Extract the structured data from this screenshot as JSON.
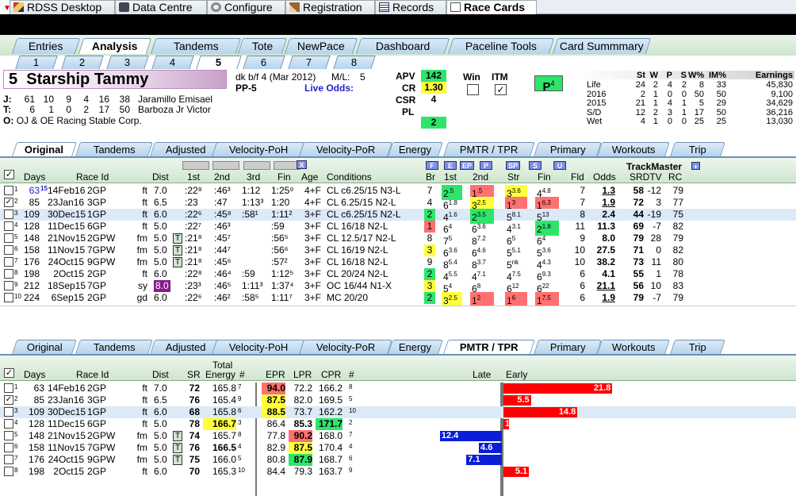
{
  "top_tabs": [
    {
      "label": "RDSS Desktop",
      "icon": "pencil-icon"
    },
    {
      "label": "Data Centre",
      "icon": "camera-icon"
    },
    {
      "label": "Configure",
      "icon": "gear-icon"
    },
    {
      "label": "Registration",
      "icon": "edit-icon"
    },
    {
      "label": "Records",
      "icon": "grid-icon"
    },
    {
      "label": "Race Cards",
      "icon": "document-icon"
    }
  ],
  "main_tabs": [
    "Entries",
    "Analysis",
    "Tandems",
    "Tote",
    "NewPace",
    "Dashboard",
    "Paceline Tools",
    "Card Summmary"
  ],
  "num_tabs": [
    "1",
    "2",
    "3",
    "4",
    "5",
    "6",
    "7",
    "8"
  ],
  "horse": {
    "number": "5",
    "name": "Starship Tammy",
    "breeding": "dk b/f 4  (Mar 2012)",
    "ml_label": "M/L:",
    "ml_value": "5",
    "pp": "PP-5",
    "live_odds": "Live Odds:",
    "jockey_label": "J:",
    "jockey_stats": [
      "61",
      "10",
      "9",
      "4",
      "16",
      "38"
    ],
    "jockey_name": "Jaramillo Emisael",
    "trainer_label": "T:",
    "trainer_stats": [
      "6",
      "1",
      "0",
      "2",
      "17",
      "50"
    ],
    "trainer_name": "Barboza Jr Victor",
    "owner_label": "O:",
    "owner_name": "OJ & OE Racing Stable Corp."
  },
  "ratings": {
    "apv_label": "APV",
    "apv": "142",
    "cr_label": "CR",
    "cr": "1.30",
    "csr_label": "CSR",
    "csr": "4",
    "pl_label": "PL",
    "pl": "2",
    "win_label": "Win",
    "itm_label": "ITM",
    "p_label": "P",
    "p_sup": "4"
  },
  "stats": {
    "headers": [
      "St",
      "W",
      "P",
      "S",
      "W%",
      "IM%",
      "Earnings"
    ],
    "rows": [
      {
        "label": "Life",
        "v": [
          "24",
          "2",
          "4",
          "2",
          "8",
          "33",
          "45,830"
        ]
      },
      {
        "label": "2016",
        "v": [
          "2",
          "1",
          "0",
          "0",
          "50",
          "50",
          "9,100"
        ]
      },
      {
        "label": "2015",
        "v": [
          "21",
          "1",
          "4",
          "1",
          "5",
          "29",
          "34,629"
        ]
      },
      {
        "label": "S/D",
        "v": [
          "12",
          "2",
          "3",
          "1",
          "17",
          "50",
          "36,216"
        ]
      },
      {
        "label": "Wet",
        "v": [
          "4",
          "1",
          "0",
          "0",
          "25",
          "25",
          "13,030"
        ]
      }
    ]
  },
  "section_tabs": [
    "Original",
    "Tandems",
    "Adjusted",
    "Velocity-PoH",
    "Velocity-PoR",
    "Energy",
    "PMTR / TPR",
    "Primary",
    "Workouts",
    "Trip"
  ],
  "orig": {
    "headers": {
      "days": "Days",
      "race": "Race Id",
      "dist": "Dist",
      "first": "1st",
      "second": "2nd",
      "third": "3rd",
      "fin": "Fin",
      "age": "Age",
      "cond": "Conditions",
      "br": "Br",
      "c1": "1st",
      "c2": "2nd",
      "str": "Str",
      "fin2": "Fin",
      "fld": "Fld",
      "odds": "Odds",
      "tm": "TrackMaster",
      "srdtv": "SRDTV",
      "rc": "RC"
    },
    "pbtns": [
      "F",
      "E",
      "EP",
      "P",
      "SP",
      "S",
      "U"
    ],
    "rows": [
      {
        "n": "1",
        "days": "63",
        "dsup": "15",
        "date": "14Feb16",
        "trk": "2GP",
        "sur": "ft",
        "dist": "7.0",
        "f1": ":22⁸",
        ":f2": "",
        "f2": ":46³",
        "f3": "1:12",
        "fin": "1:25⁹",
        "age": "4+F",
        "cond": "CL c6.25/15 N3-L",
        "br": "7",
        "c1": "2",
        "c1s": ".5",
        "c2": "1",
        "c2s": ".5",
        "st": "3",
        "sts": "3.6",
        "fi": "4",
        "fis": "4.8",
        "fld": "7",
        "odds": "1.3",
        "sr": "58",
        "dtv": "-12",
        "rc": "79"
      },
      {
        "n": "2",
        "days": "85",
        "dsup": "",
        "date": "23Jan16",
        "trk": "3GP",
        "sur": "ft",
        "dist": "6.5",
        "f1": ":23",
        "f2": ":47",
        "f3": "1:13³",
        "fin": "1:20",
        "age": "4+F",
        "cond": "CL 6.25/15 N2-L",
        "br": "4",
        "c1": "6",
        "c1s": "1.8",
        "c2": "3",
        "c2s": "2.5",
        "st": "1",
        "sts": "3",
        "fi": "1",
        "fis": "6.3",
        "fld": "7",
        "odds": "1.9",
        "sr": "72",
        "dtv": "3",
        "rc": "77"
      },
      {
        "n": "3",
        "days": "109",
        "dsup": "",
        "date": "30Dec15",
        "trk": "1GP",
        "sur": "ft",
        "dist": "6.0",
        "f1": ":22⁶",
        "f2": ":45⁸",
        "f3": ":58¹",
        "fin": "1:11²",
        "age": "3+F",
        "cond": "CL c6.25/15 N2-L",
        "br": "2",
        "c1": "4",
        "c1s": "1.6",
        "c2": "2",
        "c2s": "3.5",
        "st": "5",
        "sts": "8.1",
        "fi": "5",
        "fis": "13",
        "fld": "8",
        "odds": "2.4",
        "sr": "44",
        "dtv": "-19",
        "rc": "75"
      },
      {
        "n": "4",
        "days": "128",
        "dsup": "",
        "date": "11Dec15",
        "trk": "6GP",
        "sur": "ft",
        "dist": "5.0",
        "f1": ":22⁷",
        "f2": ":46³",
        "f3": "",
        "fin": ":59",
        "age": "3+F",
        "cond": "CL 16/18 N2-L",
        "br": "1",
        "c1": "6",
        "c1s": "4",
        "c2": "6",
        "c2s": "3.6",
        "st": "4",
        "sts": "3.1",
        "fi": "2",
        "fis": "1.8",
        "fld": "11",
        "odds": "11.3",
        "sr": "69",
        "dtv": "-7",
        "rc": "82"
      },
      {
        "n": "5",
        "days": "148",
        "dsup": "",
        "date": "21Nov15",
        "trk": "2GPW",
        "sur": "fm",
        "dist": "5.0",
        "f1": ":21⁸",
        "f2": ":45⁷",
        "f3": "",
        "fin": ":56⁵",
        "age": "3+F",
        "cond": "CL 12.5/17 N2-L",
        "br": "8",
        "c1": "7",
        "c1s": "5",
        "c2": "8",
        "c2s": "7.2",
        "st": "6",
        "sts": "5",
        "fi": "6",
        "fis": "4",
        "fld": "9",
        "odds": "8.0",
        "sr": "79",
        "dtv": "28",
        "rc": "79"
      },
      {
        "n": "6",
        "days": "158",
        "dsup": "",
        "date": "11Nov15",
        "trk": "7GPW",
        "sur": "fm",
        "dist": "5.0",
        "f1": ":21⁸",
        "f2": ":44⁷",
        "f3": "",
        "fin": ":56⁶",
        "age": "3+F",
        "cond": "CL 16/19 N2-L",
        "br": "3",
        "c1": "6",
        "c1s": "3.6",
        "c2": "6",
        "c2s": "4.6",
        "st": "5",
        "sts": "5.1",
        "fi": "5",
        "fis": "3.6",
        "fld": "10",
        "odds": "27.5",
        "sr": "71",
        "dtv": "0",
        "rc": "82"
      },
      {
        "n": "7",
        "days": "176",
        "dsup": "",
        "date": "24Oct15",
        "trk": "9GPW",
        "sur": "fm",
        "dist": "5.0",
        "f1": ":21⁸",
        "f2": ":45⁶",
        "f3": "",
        "fin": ":57²",
        "age": "3+F",
        "cond": "CL 16/18 N2-L",
        "br": "9",
        "c1": "8",
        "c1s": "5.4",
        "c2": "8",
        "c2s": "3.7",
        "st": "5",
        "sts": "nk",
        "fi": "4",
        "fis": "4.3",
        "fld": "10",
        "odds": "38.2",
        "sr": "73",
        "dtv": "11",
        "rc": "80"
      },
      {
        "n": "8",
        "days": "198",
        "dsup": "",
        "date": "2Oct15",
        "trk": "2GP",
        "sur": "ft",
        "dist": "6.0",
        "f1": ":22⁸",
        "f2": ":46⁴",
        "f3": ":59",
        "fin": "1:12⁵",
        "age": "3+F",
        "cond": "CL 20/24 N2-L",
        "br": "2",
        "c1": "4",
        "c1s": "5.5",
        "c2": "4",
        "c2s": "7.1",
        "st": "4",
        "sts": "7.5",
        "fi": "6",
        "fis": "9.3",
        "fld": "6",
        "odds": "4.1",
        "sr": "55",
        "dtv": "1",
        "rc": "78"
      },
      {
        "n": "9",
        "days": "212",
        "dsup": "",
        "date": "18Sep15",
        "trk": "7GP",
        "sur": "sy",
        "dist": "8.0",
        "f1": ":23³",
        "f2": ":46⁵",
        "f3": "1:11³",
        "fin": "1:37⁴",
        "age": "3+F",
        "cond": "OC 16/44 N1-X",
        "br": "3",
        "c1": "5",
        "c1s": "4",
        "c2": "6",
        "c2s": "8",
        "st": "6",
        "sts": "12",
        "fi": "6",
        "fis": "22",
        "fld": "6",
        "odds": "21.1",
        "sr": "56",
        "dtv": "10",
        "rc": "83"
      },
      {
        "n": "10",
        "days": "224",
        "dsup": "",
        "date": "6Sep15",
        "trk": "2GP",
        "sur": "gd",
        "dist": "6.0",
        "f1": ":22⁶",
        "f2": ":46²",
        "f3": ":58⁵",
        "fin": "1:11⁷",
        "age": "3+F",
        "cond": "MC 20/20",
        "br": "2",
        "c1": "3",
        "c1s": "2.5",
        "c2": "1",
        "c2s": "2",
        "st": "1",
        "sts": "6",
        "fi": "1",
        "fis": "7.5",
        "fld": "6",
        "odds": "1.9",
        "sr": "79",
        "dtv": "-7",
        "rc": "79"
      }
    ]
  },
  "pmtr": {
    "headers": {
      "days": "Days",
      "race": "Race Id",
      "dist": "Dist",
      "sr": "SR",
      "total": "Total",
      "energy": "Energy",
      "hash": "#",
      "epr": "EPR",
      "lpr": "LPR",
      "cpr": "CPR",
      "hash2": "#",
      "late": "Late",
      "early": "Early"
    },
    "rows": [
      {
        "n": "1",
        "days": "63",
        "date": "14Feb16",
        "trk": "2GP",
        "sur": "ft",
        "dist": "7.0",
        "sr": "72",
        "en": "165.8",
        "ens": "7",
        "epr": "94.0",
        "lpr": "72.2",
        "cpr": "166.2",
        "h": "8",
        "bar": 21.8
      },
      {
        "n": "2",
        "days": "85",
        "date": "23Jan16",
        "trk": "3GP",
        "sur": "ft",
        "dist": "6.5",
        "sr": "76",
        "en": "165.4",
        "ens": "9",
        "epr": "87.5",
        "lpr": "82.0",
        "cpr": "169.5",
        "h": "5",
        "bar": 5.5
      },
      {
        "n": "3",
        "days": "109",
        "date": "30Dec15",
        "trk": "1GP",
        "sur": "ft",
        "dist": "6.0",
        "sr": "68",
        "en": "165.8",
        "ens": "6",
        "epr": "88.5",
        "lpr": "73.7",
        "cpr": "162.2",
        "h": "10",
        "bar": 14.8
      },
      {
        "n": "4",
        "days": "128",
        "date": "11Dec15",
        "trk": "6GP",
        "sur": "ft",
        "dist": "5.0",
        "sr": "78",
        "en": "166.7",
        "ens": "3",
        "epr": "86.4",
        "lpr": "85.3",
        "cpr": "171.7",
        "h": "2",
        "bar": 1.1
      },
      {
        "n": "5",
        "days": "148",
        "date": "21Nov15",
        "trk": "2GPW",
        "sur": "fm",
        "dist": "5.0",
        "sr": "74",
        "en": "165.7",
        "ens": "8",
        "epr": "77.8",
        "lpr": "90.2",
        "cpr": "168.0",
        "h": "7",
        "bar": -12.4
      },
      {
        "n": "6",
        "days": "158",
        "date": "11Nov15",
        "trk": "7GPW",
        "sur": "fm",
        "dist": "5.0",
        "sr": "76",
        "en": "166.5",
        "ens": "4",
        "epr": "82.9",
        "lpr": "87.5",
        "cpr": "170.4",
        "h": "4",
        "bar": -4.6
      },
      {
        "n": "7",
        "days": "176",
        "date": "24Oct15",
        "trk": "9GPW",
        "sur": "fm",
        "dist": "5.0",
        "sr": "75",
        "en": "166.0",
        "ens": "5",
        "epr": "80.8",
        "lpr": "87.9",
        "cpr": "168.7",
        "h": "6",
        "bar": -7.1
      },
      {
        "n": "8",
        "days": "198",
        "date": "2Oct15",
        "trk": "2GP",
        "sur": "ft",
        "dist": "6.0",
        "sr": "70",
        "en": "165.3",
        "ens": "10",
        "epr": "84.4",
        "lpr": "79.3",
        "cpr": "163.7",
        "h": "9",
        "bar": 5.1
      }
    ]
  }
}
